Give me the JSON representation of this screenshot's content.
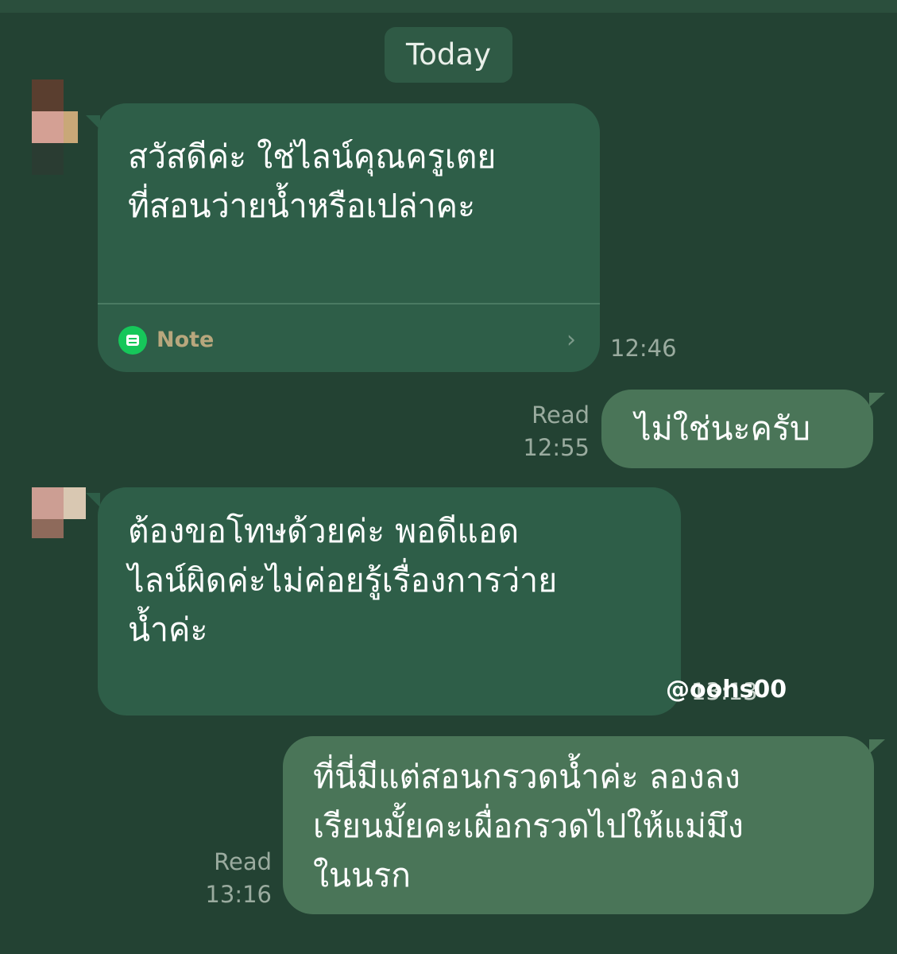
{
  "chat": {
    "date_separator": "Today",
    "messages": [
      {
        "direction": "incoming",
        "text": "สวัสดีค่ะ ใช่ไลน์คุณครูเตย\nที่สอนว่ายน้ำหรือเปล่าคะ",
        "attachment_label": "Note",
        "time": "12:46"
      },
      {
        "direction": "outgoing",
        "text": "ไม่ใช่นะครับ",
        "status": "Read",
        "time": "12:55"
      },
      {
        "direction": "incoming",
        "text": "ต้องขอโทษด้วยค่ะ พอดีแอด\nไลน์ผิดค่ะไม่ค่อยรู้เรื่องการว่าย\nน้ำค่ะ",
        "time": "13:13"
      },
      {
        "direction": "outgoing",
        "text": "ที่นี่มีแต่สอนกรวดน้ำค่ะ ลองลง\nเรียนมั้ยคะเผื่อกรวดไปให้แม่มึง\nในนรก",
        "status": "Read",
        "time": "13:16"
      }
    ]
  },
  "watermark": "@oohs00",
  "icons": {
    "note": "note-icon",
    "chevron": "chevron-right-icon"
  },
  "colors": {
    "background": "#234233",
    "incoming_bubble": "#2e5e48",
    "outgoing_bubble": "#4a7558",
    "note_icon": "#16c75a",
    "note_label": "#b8a77d"
  }
}
